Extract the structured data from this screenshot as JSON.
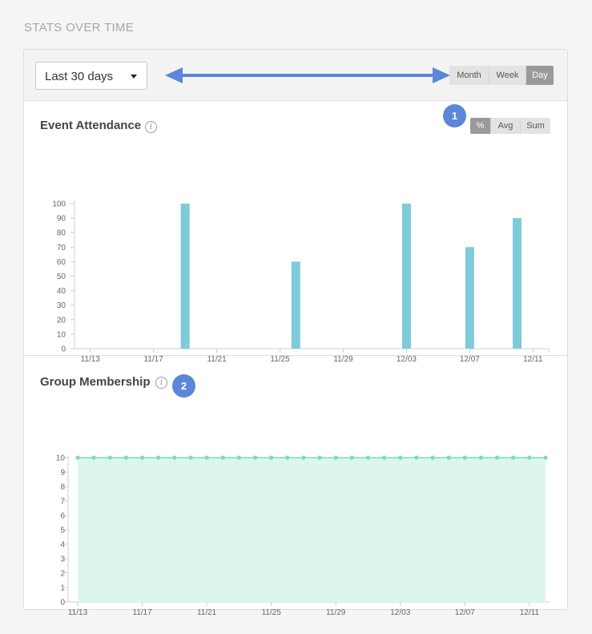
{
  "page": {
    "section_title": "STATS OVER TIME"
  },
  "toolbar": {
    "range_value": "Last 30 days",
    "period_buttons": [
      {
        "label": "Month",
        "active": false
      },
      {
        "label": "Week",
        "active": false
      },
      {
        "label": "Day",
        "active": true
      }
    ]
  },
  "attendance": {
    "title": "Event Attendance",
    "info_icon": "info-icon",
    "badge": "1",
    "metric_buttons": [
      {
        "label": "%",
        "active": true
      },
      {
        "label": "Avg",
        "active": false
      },
      {
        "label": "Sum",
        "active": false
      }
    ]
  },
  "membership": {
    "title": "Group Membership",
    "info_icon": "info-icon",
    "badge": "2"
  },
  "colors": {
    "accent_blue": "#5b86d9",
    "bar_color": "#7ecbd9",
    "area_fill": "#ddf6ec",
    "area_line": "#7fdcb2",
    "active_button": "#9a9a9a"
  },
  "chart_data": [
    {
      "type": "bar",
      "title": "Event Attendance",
      "x_tick_labels": [
        "11/13",
        "11/17",
        "11/21",
        "11/25",
        "11/29",
        "12/03",
        "12/07",
        "12/11"
      ],
      "y_ticks": [
        0,
        10,
        20,
        30,
        40,
        50,
        60,
        70,
        80,
        90,
        100
      ],
      "ylim": [
        0,
        100
      ],
      "days": [
        "11/12",
        "11/13",
        "11/14",
        "11/15",
        "11/16",
        "11/17",
        "11/18",
        "11/19",
        "11/20",
        "11/21",
        "11/22",
        "11/23",
        "11/24",
        "11/25",
        "11/26",
        "11/27",
        "11/28",
        "11/29",
        "11/30",
        "12/01",
        "12/02",
        "12/03",
        "12/04",
        "12/05",
        "12/06",
        "12/07",
        "12/08",
        "12/09",
        "12/10",
        "12/11",
        "12/12"
      ],
      "bars": [
        {
          "x": "11/19",
          "y": 100
        },
        {
          "x": "11/26",
          "y": 60
        },
        {
          "x": "12/03",
          "y": 100
        },
        {
          "x": "12/07",
          "y": 70
        },
        {
          "x": "12/10",
          "y": 90
        }
      ]
    },
    {
      "type": "area",
      "title": "Group Membership",
      "x_tick_labels": [
        "11/13",
        "11/17",
        "11/21",
        "11/25",
        "11/29",
        "12/03",
        "12/07",
        "12/11"
      ],
      "y_ticks": [
        0,
        1,
        2,
        3,
        4,
        5,
        6,
        7,
        8,
        9,
        10
      ],
      "ylim": [
        0,
        10
      ],
      "days": [
        "11/13",
        "11/14",
        "11/15",
        "11/16",
        "11/17",
        "11/18",
        "11/19",
        "11/20",
        "11/21",
        "11/22",
        "11/23",
        "11/24",
        "11/25",
        "11/26",
        "11/27",
        "11/28",
        "11/29",
        "11/30",
        "12/01",
        "12/02",
        "12/03",
        "12/04",
        "12/05",
        "12/06",
        "12/07",
        "12/08",
        "12/09",
        "12/10",
        "12/11",
        "12/12"
      ],
      "values": [
        10,
        10,
        10,
        10,
        10,
        10,
        10,
        10,
        10,
        10,
        10,
        10,
        10,
        10,
        10,
        10,
        10,
        10,
        10,
        10,
        10,
        10,
        10,
        10,
        10,
        10,
        10,
        10,
        10,
        10
      ]
    }
  ]
}
